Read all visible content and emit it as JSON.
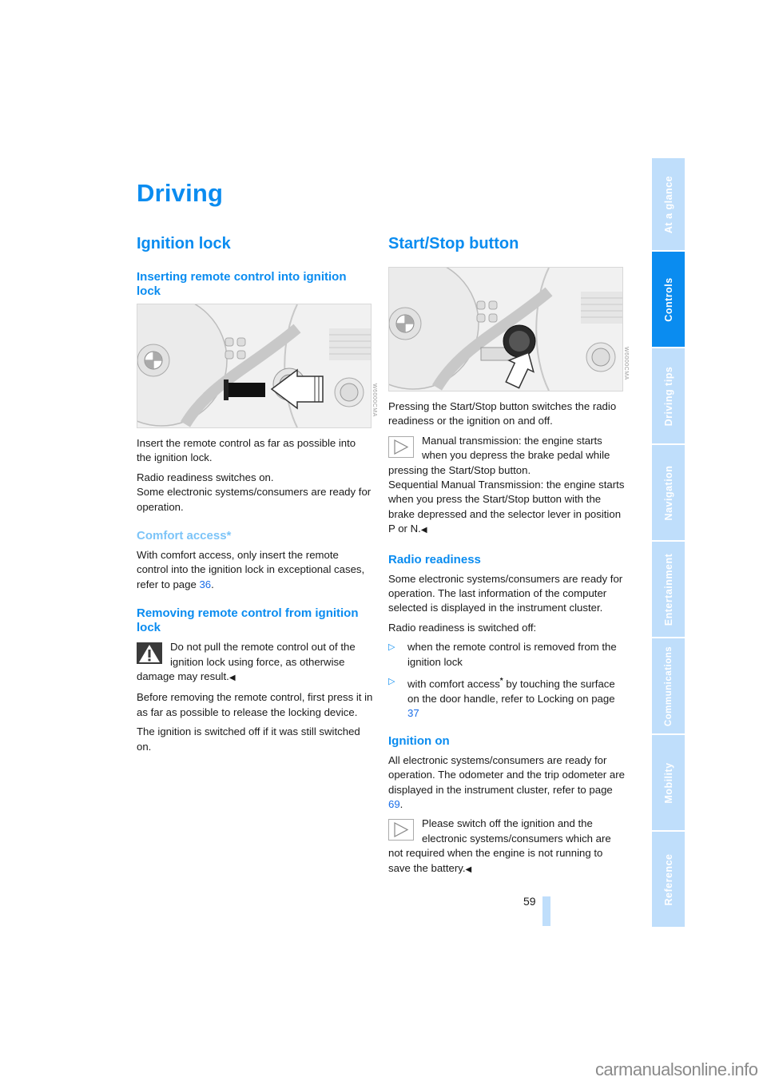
{
  "chapter_title": "Driving",
  "left": {
    "section_title": "Ignition lock",
    "sub1_title": "Inserting remote control into ignition lock",
    "figure1_code": "W6000CMA",
    "p1": "Insert the remote control as far as possible into the ignition lock.",
    "p2a": "Radio readiness switches on.",
    "p2b": "Some electronic systems/consumers are ready for operation.",
    "sub2_title": "Comfort access*",
    "p3_text": "With comfort access, only insert the remote control into the ignition lock in exceptional cases, refer to page ",
    "p3_link": "36",
    "p3_end": ".",
    "sub3_title": "Removing remote control from ignition lock",
    "warning_text": "Do not pull the remote control out of the ignition lock using force, as otherwise damage may result.",
    "end_mark": "◀",
    "p4": "Before removing the remote control, first press it in as far as possible to release the locking device.",
    "p5": "The ignition is switched off if it was still switched on."
  },
  "right": {
    "section_title": "Start/Stop button",
    "figure2_code": "W6000CMA",
    "p1": "Pressing the Start/Stop button switches the radio readiness or the ignition on and off.",
    "note1_text": "Manual transmission: the engine starts when you depress the brake pedal while pressing the Start/Stop button.",
    "note1_text2": "Sequential Manual Transmission: the engine starts when you press the Start/Stop button with the brake depressed and the selector lever in position P or N.",
    "end_mark": "◀",
    "sub1_title": "Radio readiness",
    "p2": "Some electronic systems/consumers are ready for operation. The last information of the computer selected is displayed in the instrument cluster.",
    "p3": "Radio readiness is switched off:",
    "bullets": [
      {
        "marker": "▷",
        "text": "when the remote control is removed from the ignition lock"
      },
      {
        "marker": "▷",
        "text_a": "with comfort access",
        "star": "*",
        "text_b": " by touching the surface on the door handle, refer to Locking on page ",
        "link": "37"
      }
    ],
    "sub2_title": "Ignition on",
    "p4_text": "All electronic systems/consumers are ready for operation. The odometer and the trip odometer are displayed in the instrument cluster, refer to page ",
    "p4_link": "69",
    "p4_end": ".",
    "note2_text": "Please switch off the ignition and the electronic systems/consumers which are not required when the engine is not running to save the battery."
  },
  "side_tabs": [
    {
      "label": "At a glance",
      "active": false
    },
    {
      "label": "Controls",
      "active": true
    },
    {
      "label": "Driving tips",
      "active": false
    },
    {
      "label": "Navigation",
      "active": false
    },
    {
      "label": "Entertainment",
      "active": false
    },
    {
      "label": "Communications",
      "active": false
    },
    {
      "label": "Mobility",
      "active": false
    },
    {
      "label": "Reference",
      "active": false
    }
  ],
  "page_number": "59",
  "watermark": "carmanualsonline.info"
}
